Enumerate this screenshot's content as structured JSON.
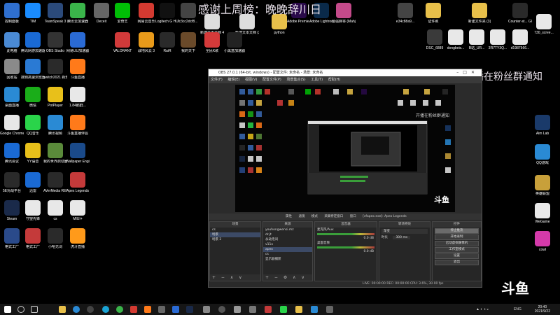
{
  "desktop": {
    "banner_top": "感谢上周榜：晚晚辞川日",
    "banner_right": "开播在粉丝群通知",
    "watermark": "斗鱼",
    "icons_left": [
      {
        "label": "控制面板",
        "icon": "control-panel-icon",
        "color": "#2f6fcf"
      },
      {
        "label": "TIM",
        "icon": "tim-icon",
        "color": "#1a8cff"
      },
      {
        "label": "TeamSpeak 3",
        "icon": "teamspeak-icon",
        "color": "#2b4a7a"
      },
      {
        "label": "腾讯云加速器",
        "icon": "accelerator-icon",
        "color": "#3ab54a"
      },
      {
        "label": "Deceit",
        "icon": "deceit-icon",
        "color": "#666666"
      },
      {
        "label": "爱奇艺",
        "icon": "iqiyi-icon",
        "color": "#00be06"
      },
      {
        "label": "网易云音乐",
        "icon": "netease-music-icon",
        "color": "#d33a31"
      },
      {
        "label": "Logitech G HUB",
        "icon": "logitech-icon",
        "color": "#111111"
      },
      {
        "label": "c3cc2dcf8...",
        "icon": "file-icon",
        "color": "#444444"
      },
      {
        "label": "新建文本文档 48199cf57...",
        "icon": "text-file-icon",
        "color": "#dddddd"
      },
      {
        "label": "新建文本文档 (2)",
        "icon": "text-file-icon",
        "color": "#dddddd"
      },
      {
        "label": "python",
        "icon": "python-folder-icon",
        "color": "#e8c04a"
      },
      {
        "label": "Adobe Premie...",
        "icon": "premiere-icon",
        "color": "#2a0a4a"
      },
      {
        "label": "Adobe Lightroo...",
        "icon": "lightroom-icon",
        "color": "#0a2a4a"
      },
      {
        "label": "最强麻将 (Mahjong...",
        "icon": "mahjong-icon",
        "color": "#c44a8a"
      },
      {
        "label": "此电脑",
        "icon": "this-pc-icon",
        "color": "#4a8ad4"
      },
      {
        "label": "腾讯网游加速器",
        "icon": "tencent-accel-icon",
        "color": "#1a6ad4"
      },
      {
        "label": "OBS Studio",
        "icon": "obs-icon",
        "color": "#333333"
      },
      {
        "label": "网易UU加速器",
        "icon": "uu-icon",
        "color": "#2a6ad4"
      },
      {
        "label": "VALORANT",
        "icon": "valorant-icon",
        "color": "#d13a3a"
      },
      {
        "label": "战地风云 3",
        "icon": "battlefield-icon",
        "color": "#e89a1a"
      },
      {
        "label": "RaiR",
        "icon": "rair-icon",
        "color": "#2a2a2a"
      },
      {
        "label": "我的天下",
        "icon": "game-icon",
        "color": "#6a4a2a"
      },
      {
        "label": "全民K歌",
        "icon": "kge-icon",
        "color": "#d43a3a"
      },
      {
        "label": "小黑盒加速器",
        "icon": "xiaoheihe-icon",
        "color": "#222222"
      },
      {
        "label": "回收站",
        "icon": "recycle-bin-icon",
        "color": "#8a8a8a"
      },
      {
        "label": "搜狗高速浏览器",
        "icon": "sogou-browser-icon",
        "color": "#2a7ad4"
      },
      {
        "label": "switch2021 新规划",
        "icon": "switch-icon",
        "color": "#2a2a2a"
      },
      {
        "label": "斗鱼直播",
        "icon": "douyu-icon",
        "color": "#ff7a1a"
      },
      {
        "label": "桌面直播",
        "icon": "live-icon",
        "color": "#2a8ad4"
      },
      {
        "label": "微信",
        "icon": "wechat-icon",
        "color": "#1aad19"
      },
      {
        "label": "PotPlayer",
        "icon": "potplayer-icon",
        "color": "#e8c01a"
      },
      {
        "label": "1.84鹅群...",
        "icon": "doc-icon",
        "color": "#e8e8e8"
      },
      {
        "label": "Google Chrome",
        "icon": "chrome-icon",
        "color": "#e8e8e8"
      },
      {
        "label": "QQ音乐",
        "icon": "qqmusic-icon",
        "color": "#2ad44a"
      },
      {
        "label": "腾讯视频",
        "icon": "tencent-video-icon",
        "color": "#2a8ad4"
      },
      {
        "label": "斗鱼直播伴侣",
        "icon": "douyu-companion-icon",
        "color": "#ff7a1a"
      },
      {
        "label": "腾讯会议",
        "icon": "meeting-icon",
        "color": "#1a6ad4"
      },
      {
        "label": "YY语音",
        "icon": "yy-icon",
        "color": "#e8c01a"
      },
      {
        "label": "我的世界启动器",
        "icon": "minecraft-icon",
        "color": "#5a8a3a"
      },
      {
        "label": "Wallpaper Engine",
        "icon": "wallpaper-icon",
        "color": "#1a4a8a"
      },
      {
        "label": "5E对战平台",
        "icon": "5e-icon",
        "color": "#2a2a2a"
      },
      {
        "label": "迅雷",
        "icon": "xunlei-icon",
        "color": "#1a6ad4"
      },
      {
        "label": "AVerMedia RECentral 4",
        "icon": "avermedia-icon",
        "color": "#2a2a2a"
      },
      {
        "label": "Apex Legends",
        "icon": "apex-icon",
        "color": "#c43a3a"
      },
      {
        "label": "Steam",
        "icon": "steam-icon",
        "color": "#1a2a4a"
      },
      {
        "label": "守望先锋",
        "icon": "overwatch-icon",
        "color": "#e8e8e8"
      },
      {
        "label": "cs",
        "icon": "cs-icon",
        "color": "#e8e8e8"
      },
      {
        "label": "MIUI+",
        "icon": "miui-icon",
        "color": "#e8e8e8"
      },
      {
        "label": "格式工厂",
        "icon": "format-factory-icon",
        "color": "#2a4a8a"
      },
      {
        "label": "格式工厂",
        "icon": "format-factory2-icon",
        "color": "#c43a3a"
      },
      {
        "label": "小哈无词",
        "icon": "xiaoha-icon",
        "color": "#2a2a2a"
      },
      {
        "label": "虎牙直播",
        "icon": "huya-icon",
        "color": "#ff9a1a"
      }
    ],
    "icons_right": [
      {
        "label": "e34c88a9...",
        "icon": "file-icon",
        "color": "#444444"
      },
      {
        "label": "证件照",
        "icon": "folder-icon",
        "color": "#e8c04a"
      },
      {
        "label": "新建文件夹 (3)",
        "icon": "folder-icon",
        "color": "#e8c04a"
      },
      {
        "label": "Counter-st... Global Of...",
        "icon": "csgo-icon",
        "color": "#2a2a2a"
      },
      {
        "label": "730_scree...",
        "icon": "image-icon",
        "color": "#e8e8e8"
      },
      {
        "label": "DSC_6889",
        "icon": "photo-icon",
        "color": "#3a3a3a"
      },
      {
        "label": "dongbeis...",
        "icon": "image-icon",
        "color": "#e8e8e8"
      },
      {
        "label": "B站_UR...",
        "icon": "image-icon",
        "color": "#e8e8e8"
      },
      {
        "label": "3R7TY3Q...",
        "icon": "image-icon",
        "color": "#e8e8e8"
      },
      {
        "label": "d1987566...",
        "icon": "image-icon",
        "color": "#e8e8e8"
      },
      {
        "label": "Aim Lab",
        "icon": "aimlab-icon",
        "color": "#1a3a6a"
      },
      {
        "label": "QQ游戏",
        "icon": "qqgame-icon",
        "color": "#2a8ad4"
      },
      {
        "label": "英雄联盟",
        "icon": "lol-icon",
        "color": "#c8a03a"
      },
      {
        "label": "WeGame",
        "icon": "wegame-icon",
        "color": "#e8e8e8"
      },
      {
        "label": "cowl",
        "icon": "cowl-icon",
        "color": "#d43aaa"
      }
    ]
  },
  "obs": {
    "title": "OBS 27.0.1 (64-bit, windows) - 配置文件: 未命名 - 场景: 未命名",
    "menu": [
      "文件(F)",
      "编辑(E)",
      "视图(V)",
      "配置文件(P)",
      "场景集合(S)",
      "工具(T)",
      "帮助(H)"
    ],
    "scenebar": [
      "属性",
      "滤镜",
      "模式",
      "采集特定窗口",
      "窗口",
      "[cfapex.exe]: Apex Legends"
    ],
    "docks": {
      "scenes_header": "场景",
      "scenes": [
        "cs",
        "场景",
        "场景 2"
      ],
      "sources_header": "来源",
      "sources": [
        "youhongwensi.mz",
        "dr.jt",
        "永劫无间",
        "v11x",
        "apex",
        "cs",
        "显示器捕获"
      ],
      "mixer_header": "混音器",
      "mixer": [
        {
          "name": "麦克风/Aux",
          "db": "0.0 dB"
        },
        {
          "name": "桌面音频",
          "db": "0.0 dB"
        }
      ],
      "transitions_header": "转场特效",
      "transition_type": "渐变",
      "duration_label": "时长",
      "duration_value": "300 ms",
      "controls_header": "控件",
      "controls": [
        "停止推流",
        "开始录制",
        "启动虚拟摄像机",
        "工作室模式",
        "设置",
        "退出"
      ]
    },
    "status": "LIVE: 00:00:00   REC: 00:00:00   CPU: 3.6%, 30.00 fps"
  },
  "taskbar": {
    "lang": "ENG",
    "time": "20:40",
    "date": "2021/9/22"
  }
}
